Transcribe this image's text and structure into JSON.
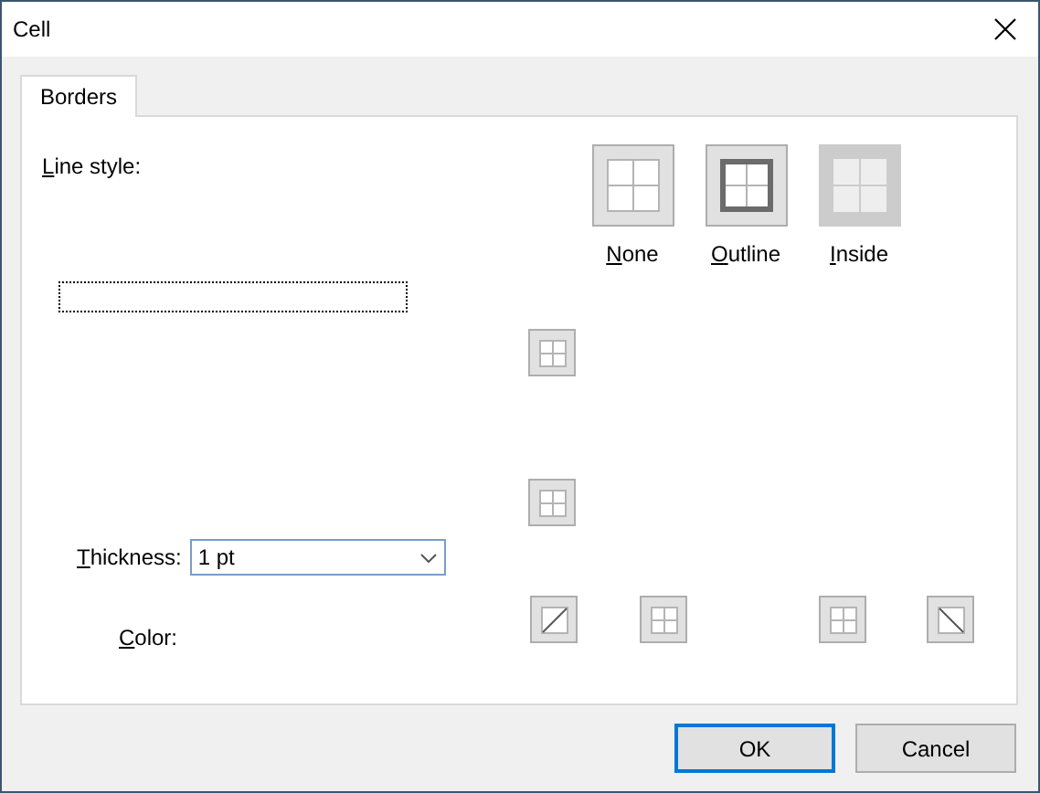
{
  "window": {
    "title": "Cell"
  },
  "tabs": [
    {
      "label": "Borders",
      "selected": true
    }
  ],
  "line_style": {
    "label": "Line style:",
    "first_letter_underlined": true
  },
  "presets": [
    {
      "label": "None",
      "first_letter_underlined": true,
      "kind": "none",
      "disabled": false
    },
    {
      "label": "Outline",
      "first_letter_underlined": true,
      "kind": "outline",
      "disabled": false
    },
    {
      "label": "Inside",
      "first_letter_underlined": true,
      "kind": "inside",
      "disabled": true
    }
  ],
  "edge_buttons_left": [
    {
      "kind": "grid"
    },
    {
      "kind": "grid"
    }
  ],
  "thickness": {
    "label": "Thickness:",
    "first_letter_underlined": true,
    "value": "1 pt"
  },
  "color": {
    "label": "Color:",
    "first_letter_underlined": true
  },
  "edge_buttons_bottom": [
    {
      "kind": "diagonal-up"
    },
    {
      "kind": "grid"
    },
    {
      "kind": "grid"
    },
    {
      "kind": "diagonal-down"
    }
  ],
  "buttons": [
    {
      "label": "OK",
      "default": true
    },
    {
      "label": "Cancel",
      "default": false
    }
  ]
}
